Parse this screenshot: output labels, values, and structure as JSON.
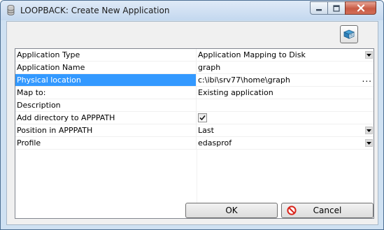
{
  "window": {
    "title": "LOOPBACK: Create New Application",
    "icons": [
      "app-icon",
      "minimize-icon",
      "maximize-icon",
      "close-icon"
    ]
  },
  "toolbar": {
    "icon": "help-book-icon"
  },
  "properties": [
    {
      "name": "Application Type",
      "value": "Application Mapping to Disk",
      "editor": "dropdown"
    },
    {
      "name": "Application Name",
      "value": "graph",
      "editor": "text"
    },
    {
      "name": "Physical location",
      "value": "c:\\ibi\\srv77\\home\\graph",
      "editor": "browse",
      "selected": true,
      "browse_label": "..."
    },
    {
      "name": "Map to:",
      "value": "Existing application",
      "editor": "dropdown-hidden"
    },
    {
      "name": "Description",
      "value": "",
      "editor": "text"
    },
    {
      "name": "Add directory to APPPATH",
      "value": "",
      "editor": "checkbox",
      "checked": true
    },
    {
      "name": "Position in APPPATH",
      "value": "Last",
      "editor": "dropdown"
    },
    {
      "name": "Profile",
      "value": "edasprof",
      "editor": "dropdown"
    }
  ],
  "buttons": {
    "ok": "OK",
    "cancel": "Cancel",
    "cancel_icon": "no-entry-icon"
  },
  "colors": {
    "selection": "#3399ff",
    "frame": "#cfe1f2",
    "close_button": "#c85a44"
  }
}
